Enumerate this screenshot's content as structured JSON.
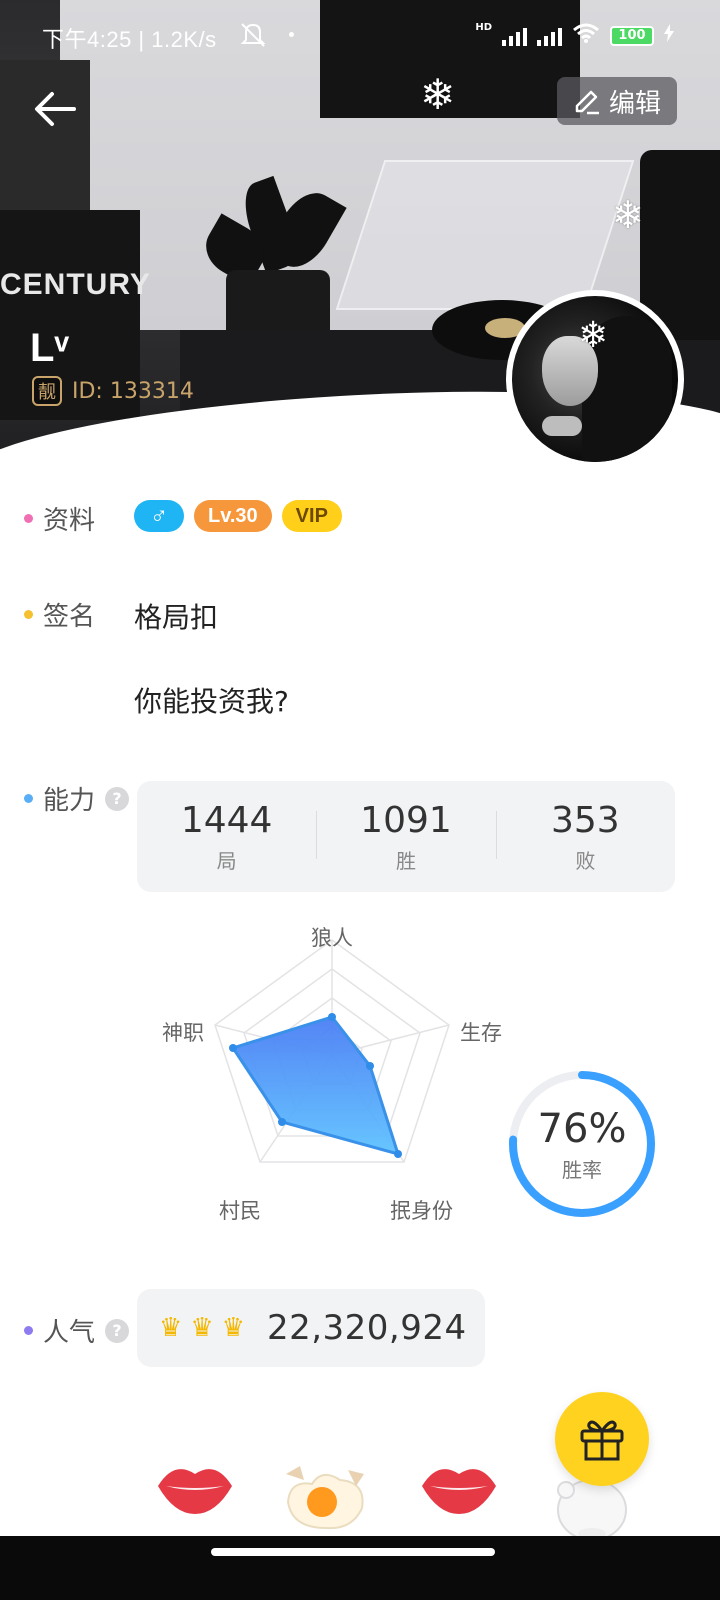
{
  "status_bar": {
    "time_speed": "下午4:25 | 1.2K/s",
    "hd_label": "HD",
    "battery": "100"
  },
  "header": {
    "edit_label": "编辑",
    "century_text": "CENTURY"
  },
  "profile": {
    "name": "Lᵛ",
    "id_badge": "靓",
    "id_text": "ID: 133314"
  },
  "info": {
    "label": "资料",
    "tags": {
      "gender": "♂",
      "level": "Lv.30",
      "vip": "VIP"
    }
  },
  "signature": {
    "label": "签名",
    "line1": "格局扣",
    "line2": "你能投资我?"
  },
  "ability": {
    "label": "能力",
    "help": "?",
    "stats": [
      {
        "value": "1444",
        "label": "局"
      },
      {
        "value": "1091",
        "label": "胜"
      },
      {
        "value": "353",
        "label": "败"
      }
    ],
    "radar_labels": {
      "top": "狼人",
      "right": "生存",
      "bottom_right": "抿身份",
      "bottom_left": "村民",
      "left": "神职"
    },
    "win_rate": "76%",
    "win_rate_label": "胜率",
    "win_rate_fraction": 0.76
  },
  "popularity": {
    "label": "人气",
    "help": "?",
    "crowns": [
      "♛",
      "♛",
      "♛"
    ],
    "value": "22,320,924"
  },
  "colors": {
    "accent_blue": "#3aa0ff",
    "gender_blue": "#1fb5f5",
    "level_orange": "#f5973a",
    "vip_yellow": "#ffcf1a",
    "gift_yellow": "#ffd21f"
  }
}
